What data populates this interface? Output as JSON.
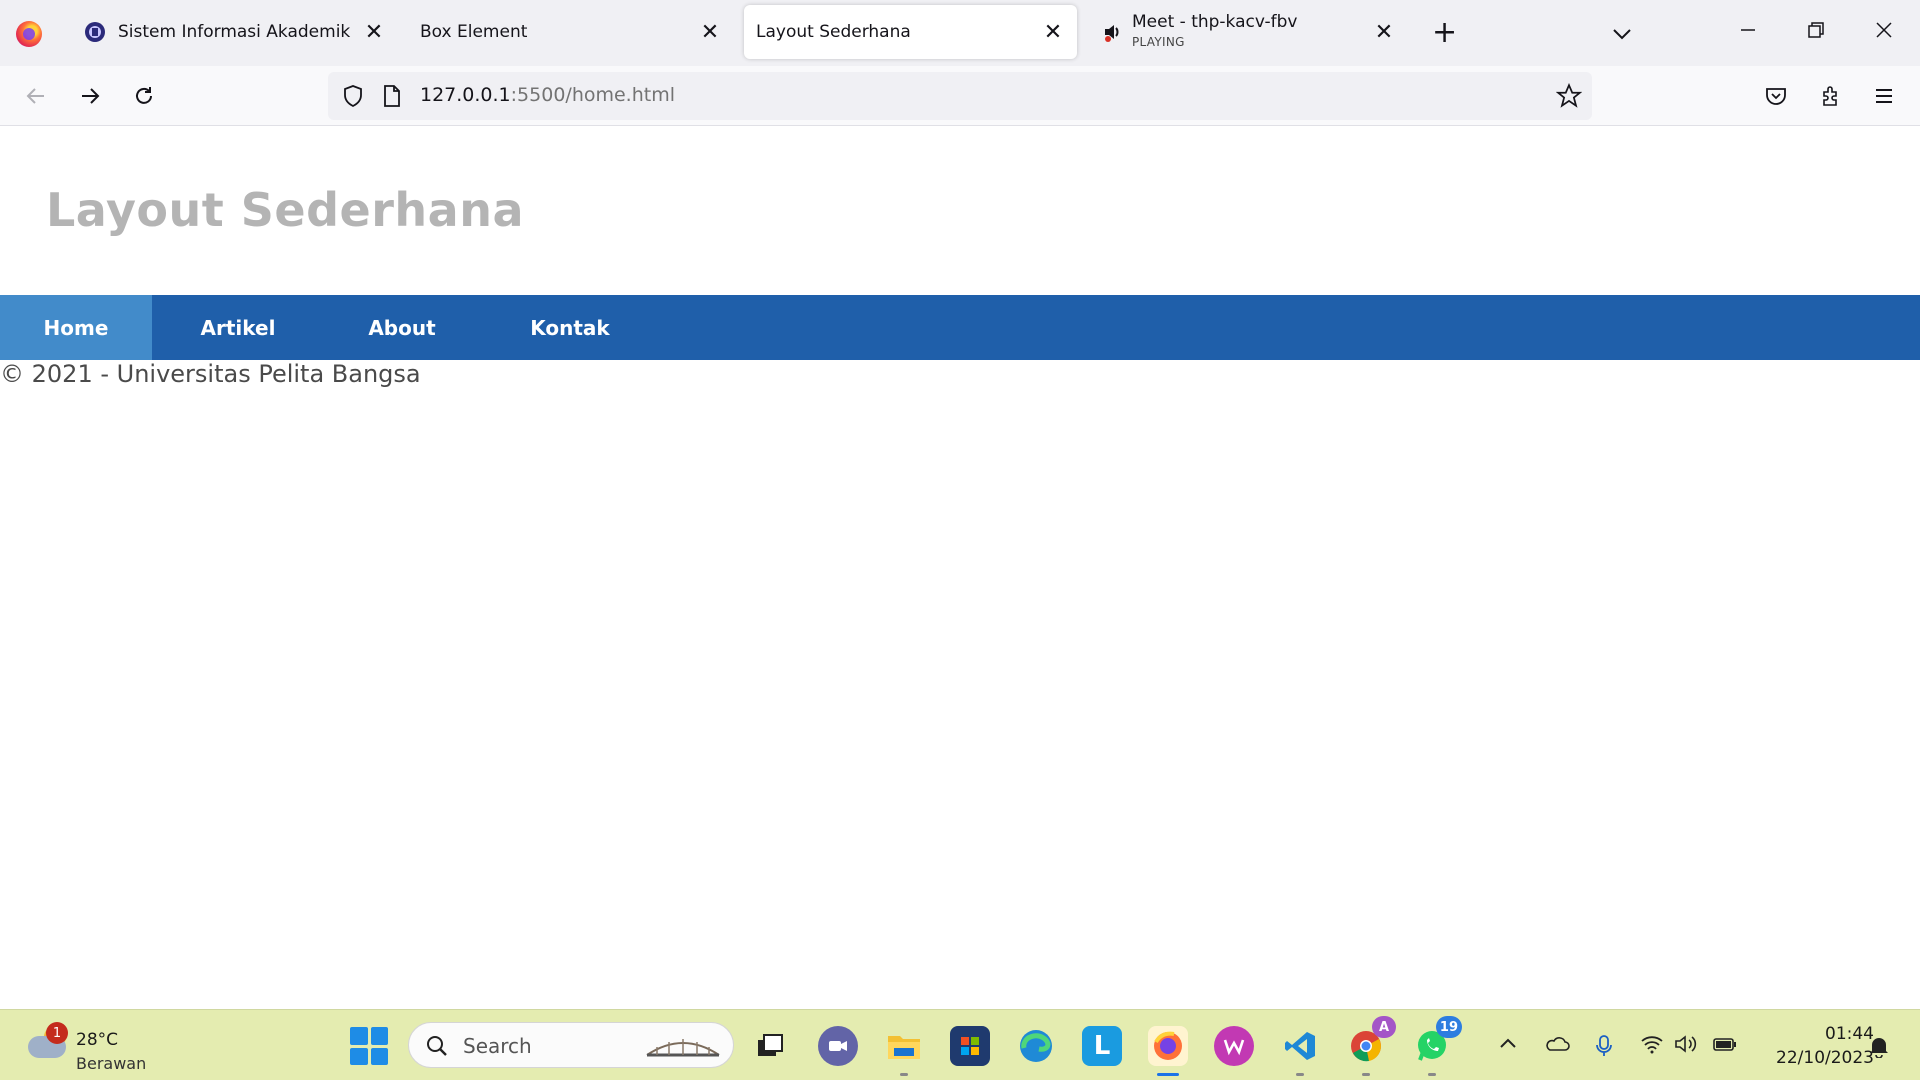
{
  "browser": {
    "tabs": [
      {
        "title": "Sistem Informasi Akademik",
        "close": "✕"
      },
      {
        "title": "Box Element",
        "close": "✕"
      },
      {
        "title": "Layout Sederhana",
        "close": "✕"
      },
      {
        "title": "Meet - thp-kacv-fbv",
        "status": "PLAYING",
        "close": "✕"
      }
    ],
    "new_tab": "+",
    "url_host": "127.0.0.1",
    "url_rest": ":5500/home.html"
  },
  "page": {
    "title": "Layout Sederhana",
    "nav": [
      {
        "label": "Home"
      },
      {
        "label": "Artikel"
      },
      {
        "label": "About"
      },
      {
        "label": "Kontak"
      }
    ],
    "footer": "© 2021 - Universitas Pelita Bangsa"
  },
  "taskbar": {
    "weather_temp": "28°C",
    "weather_desc": "Berawan",
    "weather_badge": "1",
    "search_label": "Search",
    "chrome_badge": "A",
    "whatsapp_badge": "19",
    "time": "01:44",
    "date": "22/10/2023"
  },
  "colors": {
    "nav_bg": "#1f5faa",
    "nav_active": "#428bca",
    "title_color": "#b4b4b4",
    "taskbar_bg": "#e4ecb0"
  }
}
